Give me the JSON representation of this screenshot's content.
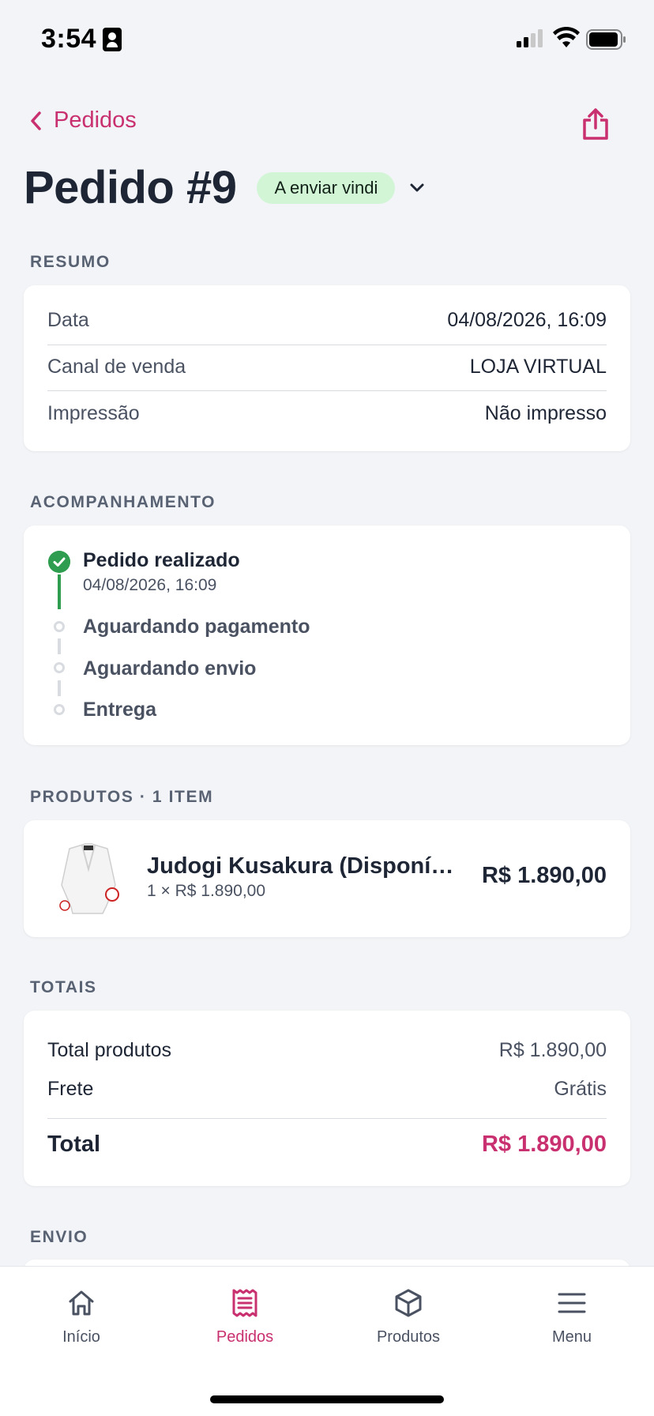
{
  "status_bar": {
    "time": "3:54"
  },
  "header": {
    "back_label": "Pedidos",
    "title": "Pedido #9",
    "status_pill": "A enviar vindi"
  },
  "resumo": {
    "label": "RESUMO",
    "rows": [
      {
        "label": "Data",
        "value": "04/08/2026, 16:09"
      },
      {
        "label": "Canal de venda",
        "value": "LOJA VIRTUAL"
      },
      {
        "label": "Impressão",
        "value": "Não impresso"
      }
    ]
  },
  "acompanhamento": {
    "label": "ACOMPANHAMENTO",
    "steps": [
      {
        "title": "Pedido realizado",
        "date": "04/08/2026, 16:09",
        "done": true
      },
      {
        "title": "Aguardando pagamento",
        "done": false
      },
      {
        "title": "Aguardando envio",
        "done": false
      },
      {
        "title": "Entrega",
        "done": false
      }
    ]
  },
  "produtos": {
    "label": "PRODUTOS · 1 ITEM",
    "items": [
      {
        "name": "Judogi Kusakura (Disponível)",
        "qty_price": "1 × R$ 1.890,00",
        "price": "R$ 1.890,00"
      }
    ]
  },
  "totais": {
    "label": "TOTAIS",
    "total_produtos_label": "Total produtos",
    "total_produtos_value": "R$ 1.890,00",
    "frete_label": "Frete",
    "frete_value": "Grátis",
    "total_label": "Total",
    "total_value": "R$ 1.890,00"
  },
  "envio": {
    "label": "ENVIO"
  },
  "tabs": [
    {
      "label": "Início",
      "icon": "home-icon",
      "active": false
    },
    {
      "label": "Pedidos",
      "icon": "receipt-icon",
      "active": true
    },
    {
      "label": "Produtos",
      "icon": "box-icon",
      "active": false
    },
    {
      "label": "Menu",
      "icon": "menu-icon",
      "active": false
    }
  ],
  "colors": {
    "accent": "#c9306f",
    "success": "#2e9d4f",
    "pill_bg": "#d2f5d6"
  }
}
